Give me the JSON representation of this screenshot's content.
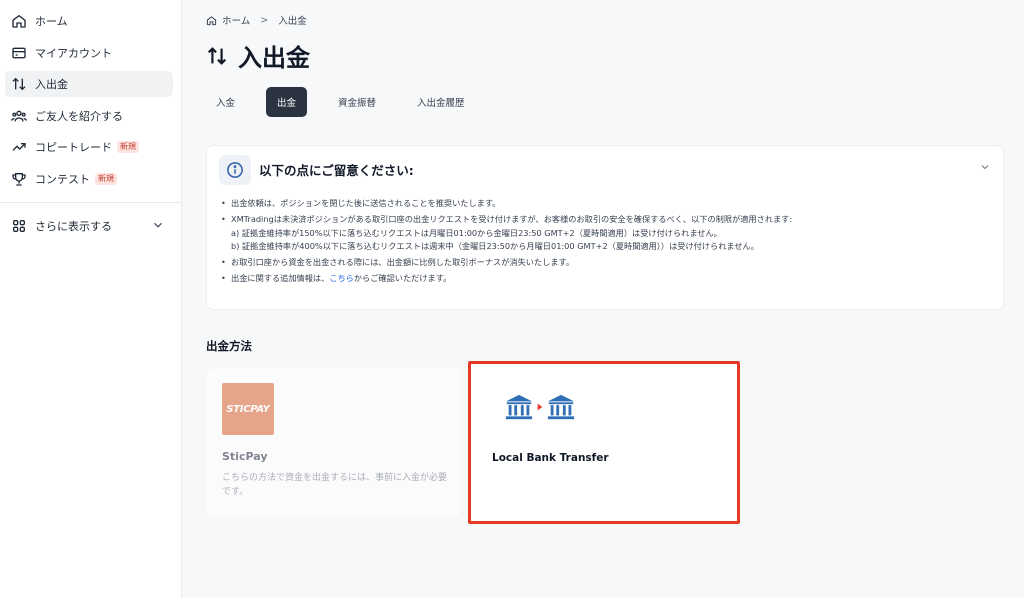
{
  "sidebar": {
    "items": [
      {
        "label": "ホーム",
        "icon": "home-icon"
      },
      {
        "label": "マイアカウント",
        "icon": "card-icon"
      },
      {
        "label": "入出金",
        "icon": "transfer-arrows-icon",
        "active": true
      },
      {
        "label": "ご友人を紹介する",
        "icon": "users-icon"
      },
      {
        "label": "コピートレード",
        "icon": "trend-up-icon",
        "badge": "新規"
      },
      {
        "label": "コンテスト",
        "icon": "trophy-icon",
        "badge": "新規"
      }
    ],
    "more": {
      "label": "さらに表示する",
      "icon": "grid-icon"
    }
  },
  "breadcrumb": {
    "home": "ホーム",
    "current": "入出金"
  },
  "page_title": "入出金",
  "tabs": [
    {
      "label": "入金"
    },
    {
      "label": "出金",
      "active": true
    },
    {
      "label": "資金振替"
    },
    {
      "label": "入出金履歴"
    }
  ],
  "notice": {
    "title": "以下の点にご留意ください:",
    "items": [
      "出金依頼は、ポジションを閉じた後に送信されることを推奨いたします。",
      "XMTradingは未決済ポジションがある取引口座の出金リクエストを受け付けますが、お客様のお取引の安全を確保するべく、以下の制限が適用されます:",
      "a) 証拠金維持率が150%以下に落ち込むリクエストは月曜日01:00から金曜日23:50 GMT+2（夏時間適用）は受け付けられません。",
      "b) 証拠金維持率が400%以下に落ち込むリクエストは週末中（金曜日23:50から月曜日01:00 GMT+2（夏時間適用））は受け付けられません。",
      "お取引口座から資金を出金される際には、出金額に比例した取引ボーナスが消失いたします。",
      "出金に関する追加情報は、",
      "こちら",
      "からご確認いただけます。"
    ]
  },
  "methods": {
    "title": "出金方法",
    "sticpay": {
      "logo_text": "STICPAY",
      "name": "SticPay",
      "desc": "こちらの方法で資金を出金するには、事前に入金が必要です。"
    },
    "bank": {
      "name": "Local Bank Transfer"
    }
  },
  "colors": {
    "accent_dark": "#2c3340",
    "highlight_border": "#e33a25",
    "link": "#2563eb",
    "bank_blue": "#2f6db5",
    "sticpay_orange": "#d9612e"
  }
}
